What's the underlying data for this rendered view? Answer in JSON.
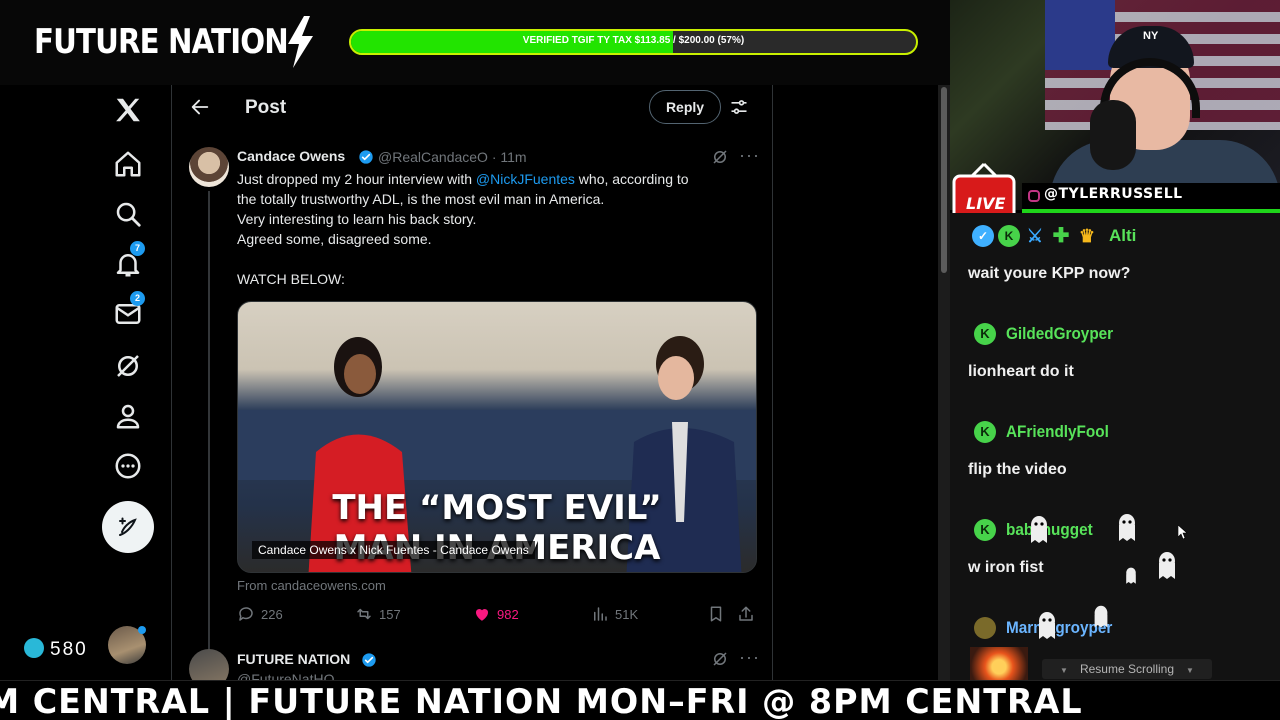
{
  "banner": {
    "brand": "FUTURE NATION",
    "goal_text": "VERIFIED TGIF TY TAX $113.85 / $200.00 (57%)",
    "goal_progress": 0.57,
    "accent_color": "#22e400"
  },
  "x_nav": {
    "items": [
      "x-logo",
      "home-icon",
      "search-icon",
      "notifications-icon",
      "messages-icon",
      "grok-icon",
      "profile-icon",
      "more-icon"
    ],
    "notifications_badge": "7",
    "messages_badge": "2",
    "points": "580"
  },
  "post": {
    "header_title": "Post",
    "reply_label": "Reply",
    "author_name": "Candace Owens",
    "author_handle": "@RealCandaceO · 11m",
    "body_line1_pre": "Just dropped my 2 hour interview with ",
    "mention": "@NickJFuentes",
    "body_line1_post": " who, according to",
    "body_line2": "the totally trustworthy ADL, is the most evil man in America.",
    "body_line3": "Very interesting to learn his back story.",
    "body_line4": "Agreed some, disagreed some.",
    "body_line5": "WATCH BELOW:",
    "media_headline_1": "THE “MOST EVIL”",
    "media_headline_2": "MAN IN AMERICA",
    "media_caption": "Candace Owens x Nick Fuentes - Candace Owens",
    "media_source": "From candaceowens.com",
    "stats": {
      "replies": "226",
      "reposts": "157",
      "likes": "982",
      "views": "51K"
    },
    "next_author": "FUTURE NATION",
    "next_handle": "@FutureNatHQ"
  },
  "stream": {
    "live_label": "LIVE",
    "handle": "@TYLERRUSSELL",
    "brand_green": "#1fd51a"
  },
  "chat": {
    "messages": [
      {
        "user": "Alti",
        "text": "wait youre KPP now?"
      },
      {
        "user": "GildedGroyper",
        "text": "lionheart do it"
      },
      {
        "user": "AFriendlyFool",
        "text": "flip the video"
      },
      {
        "user": "babynugget",
        "text": "w iron fist"
      },
      {
        "user": "Marmagroyper",
        "text": ""
      }
    ],
    "resume_label": "Resume Scrolling"
  },
  "ticker": {
    "text": "M CENTRAL   |   FUTURE NATION MON–FRI @ 8PM CENTRAL"
  }
}
